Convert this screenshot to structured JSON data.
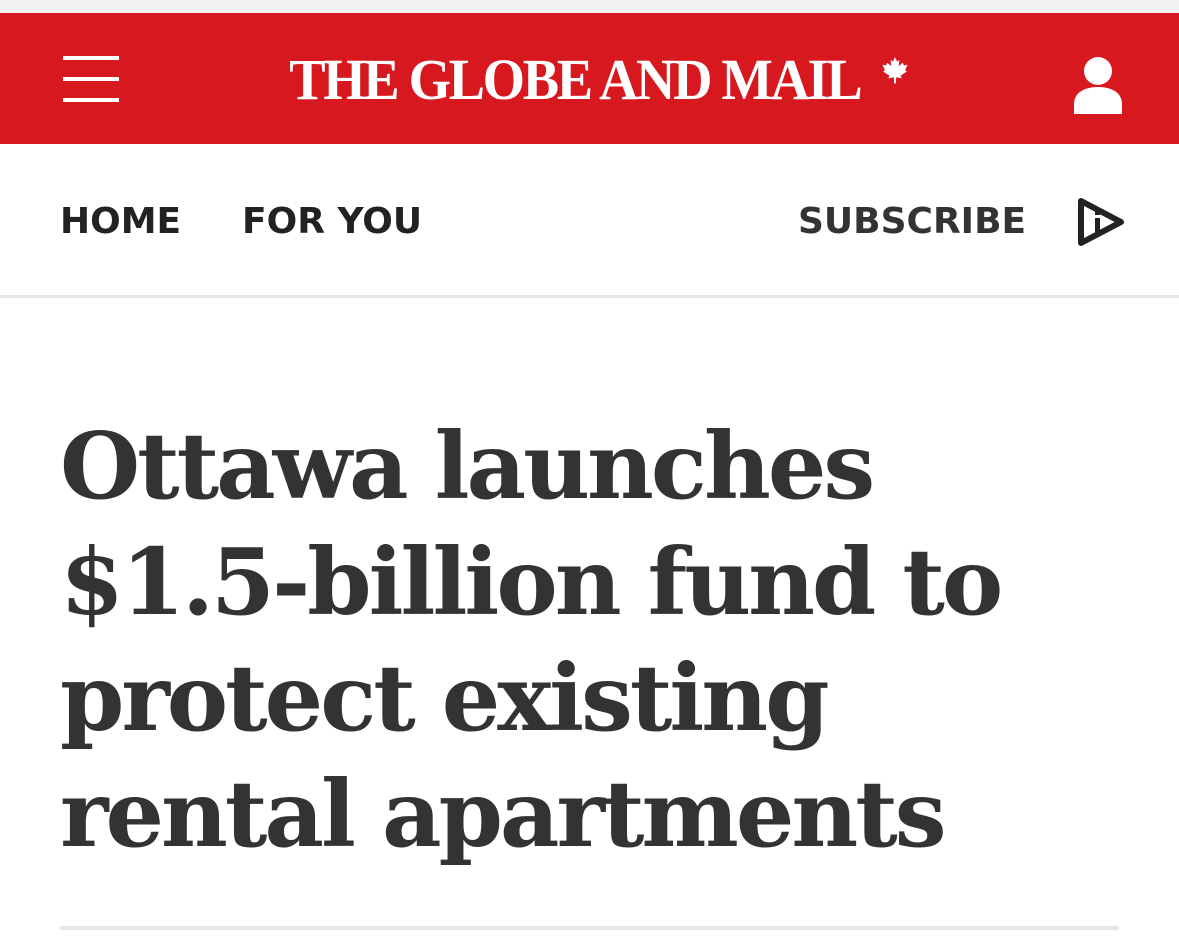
{
  "masthead": {
    "background_color": "#d7181f",
    "menu_icon": "hamburger-menu-icon",
    "logo_text": "THE GLOBE AND MAIL",
    "logo_icon": "maple-leaf-icon",
    "account_icon": "user-account-icon"
  },
  "nav": {
    "home_label": "HOME",
    "for_you_label": "FOR YOU",
    "subscribe_label": "SUBSCRIBE",
    "play_icon": "audio-play-icon"
  },
  "article": {
    "headline": "Ottawa launches $1.5-billion fund to protect existing rental apartments"
  },
  "colors": {
    "brand_red": "#d7181f",
    "text_dark": "#333333",
    "divider": "#e6e6e6"
  }
}
